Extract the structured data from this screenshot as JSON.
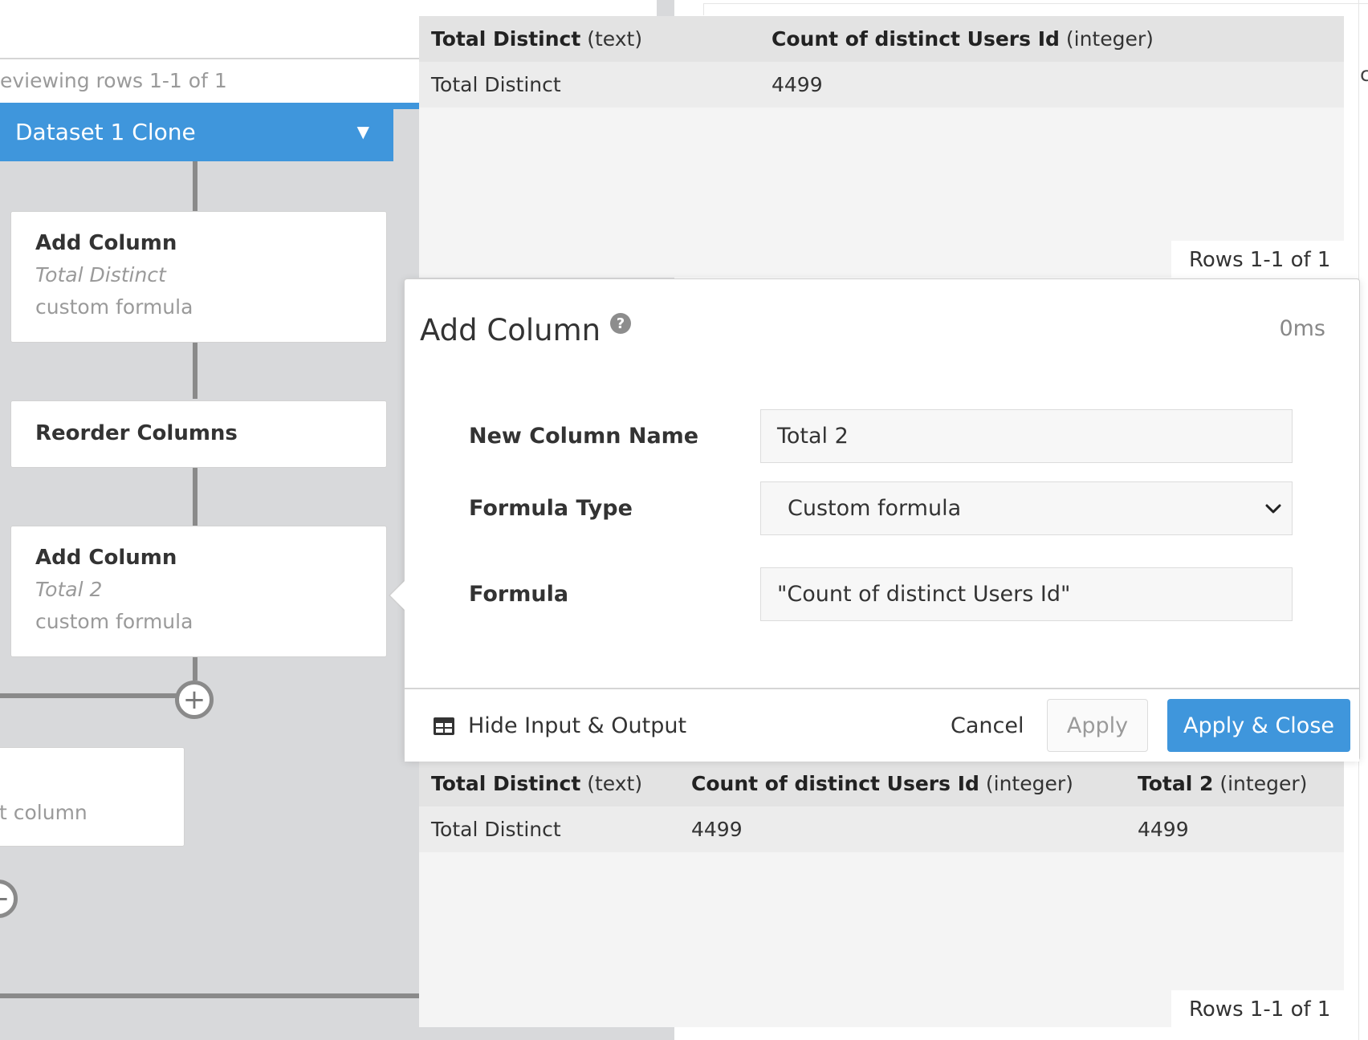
{
  "pipeline": {
    "previewing_text": "eviewing rows 1-1 of 1",
    "dataset_name": "Dataset 1 Clone",
    "steps": [
      {
        "title": "Add Column",
        "subtitle": "Total Distinct",
        "desc": "custom formula"
      },
      {
        "title": "Reorder Columns"
      },
      {
        "title": "Add Column",
        "subtitle": "Total 2",
        "desc": "custom formula"
      }
    ],
    "partial_step_text": "t column"
  },
  "input_table": {
    "columns": [
      {
        "name": "Total Distinct",
        "type": "(text)"
      },
      {
        "name": "Count of distinct Users Id",
        "type": "(integer)"
      }
    ],
    "rows": [
      [
        "Total Distinct",
        "4499"
      ]
    ],
    "rows_badge": "Rows 1-1 of 1"
  },
  "modal": {
    "title": "Add Column",
    "time": "0ms",
    "fields": {
      "new_column_label": "New Column Name",
      "new_column_value": "Total 2",
      "formula_type_label": "Formula Type",
      "formula_type_value": "Custom formula",
      "formula_label": "Formula",
      "formula_value": "\"Count of distinct Users Id\""
    },
    "footer": {
      "hide_io_label": "Hide Input & Output",
      "cancel_label": "Cancel",
      "apply_label": "Apply",
      "apply_close_label": "Apply & Close"
    }
  },
  "output_table": {
    "columns": [
      {
        "name": "Total Distinct",
        "type": "(text)"
      },
      {
        "name": "Count of distinct Users Id",
        "type": "(integer)"
      },
      {
        "name": "Total 2",
        "type": "(integer)"
      }
    ],
    "rows": [
      [
        "Total Distinct",
        "4499",
        "4499"
      ]
    ],
    "rows_badge": "Rows 1-1 of 1"
  },
  "colors": {
    "accent": "#3f96dc",
    "pipeline_bg": "#d8d9db"
  },
  "icons": {
    "help": "question-circle-icon",
    "dropdown": "caret-down-icon",
    "add": "plus-circle-icon",
    "table": "table-grid-icon",
    "select": "chevron-down-icon"
  }
}
